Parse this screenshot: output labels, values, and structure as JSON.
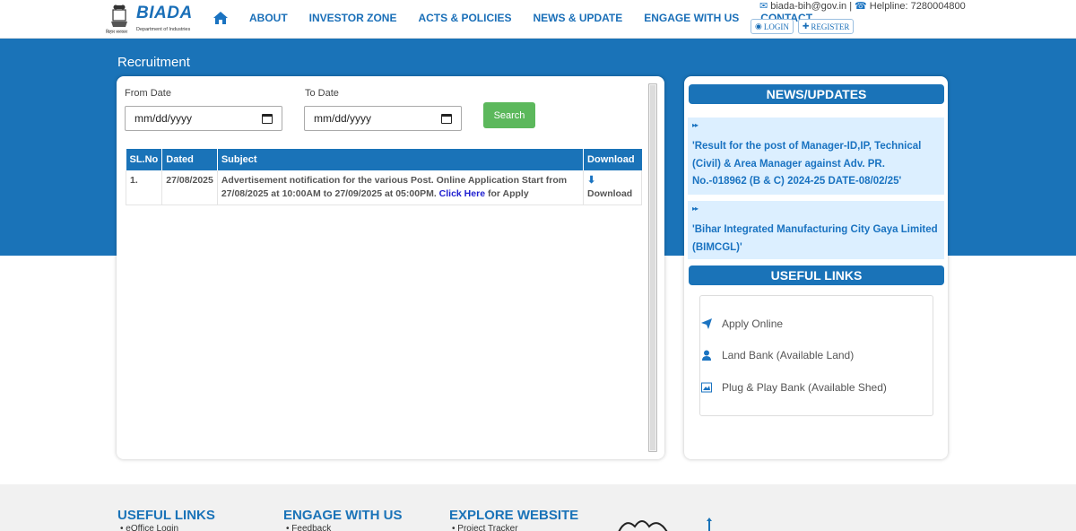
{
  "header": {
    "logo": {
      "brand": "BIADA",
      "subtitle": "Department of Industries",
      "emblem_text": "बिहार सरकार"
    },
    "nav": [
      {
        "label": "ABOUT"
      },
      {
        "label": "INVESTOR ZONE"
      },
      {
        "label": "ACTS & POLICIES"
      },
      {
        "label": "NEWS & UPDATE"
      },
      {
        "label": "ENGAGE WITH US"
      },
      {
        "label": "CONTACT"
      }
    ],
    "email": "biada-bih@gov.in",
    "separator": "|",
    "helpline": "Helpline: 7280004800",
    "login_label": "LOGIN",
    "register_label": "REGISTER"
  },
  "page": {
    "title": "Recruitment"
  },
  "filters": {
    "from_label": "From Date",
    "to_label": "To Date",
    "from_placeholder": "mm/dd/yyyy",
    "to_placeholder": "mm/dd/yyyy",
    "search_label": "Search"
  },
  "table": {
    "headers": [
      "SL.No",
      "Dated",
      "Subject",
      "Download"
    ],
    "rows": [
      {
        "sl": "1.",
        "dated": "27/08/2025",
        "subject_text": "Advertisement notification for the various Post. Online Application Start from 27/08/2025 at 10:00AM to 27/09/2025 at 05:00PM.",
        "link_label": "Click Here",
        "subject_suffix": "for Apply",
        "download_label": "Download"
      }
    ]
  },
  "news": {
    "title": "NEWS/UPDATES",
    "items": [
      {
        "marker": "▸▸",
        "text": "'Result for the post of Manager-ID,IP, Technical (Civil) & Area Manager against Adv. PR. No.-018962 (B & C) 2024-25 DATE-08/02/25'"
      },
      {
        "marker": "▸▸",
        "text": "'Bihar Integrated Manufacturing City Gaya Limited (BIMCGL)'"
      }
    ]
  },
  "useful_links": {
    "title": "USEFUL LINKS",
    "items": [
      {
        "label": "Apply Online",
        "icon": "paper-plane-icon"
      },
      {
        "label": "Land Bank (Available Land)",
        "icon": "user-icon"
      },
      {
        "label": "Plug & Play Bank (Available Shed)",
        "icon": "image-icon"
      }
    ]
  },
  "footer": {
    "columns": [
      {
        "title": "USEFUL LINKS",
        "first_item": "eOffice Login"
      },
      {
        "title": "ENGAGE WITH US",
        "first_item": "Feedback"
      },
      {
        "title": "EXPLORE WEBSITE",
        "first_item": "Project Tracker"
      }
    ]
  },
  "colors": {
    "primary": "#1a73b8",
    "search_green": "#5cb85c",
    "news_bg": "#dcefff",
    "link_blue": "#1f1fd0"
  }
}
